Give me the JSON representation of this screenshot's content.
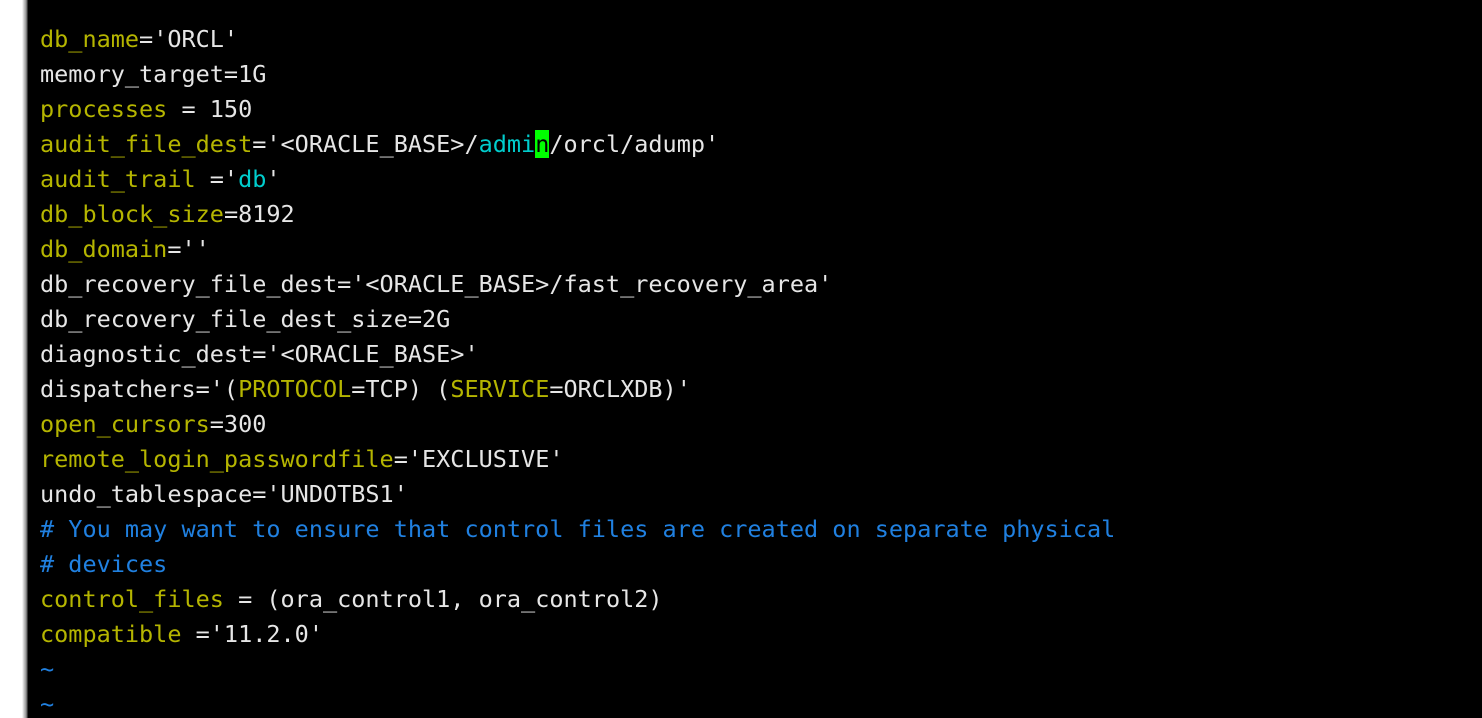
{
  "window": {
    "type": "terminal-text-editor",
    "editor": "vim",
    "background_color": "#000000",
    "gutter_color": "#ffffff"
  },
  "colors": {
    "keyword": "#b5b500",
    "value": "#e6e6e6",
    "string": "#00cdcd",
    "comment": "#2080e0",
    "cursor_bg": "#00ff00",
    "cursor_fg": "#000000",
    "background": "#000000"
  },
  "cursor": {
    "glyph": "n",
    "line_index": 3,
    "column_text": "admin"
  },
  "buffer": {
    "lines": [
      {
        "id": "line-db-name",
        "tokens": [
          {
            "t": "db_name",
            "c": "kw"
          },
          {
            "t": "='ORCL'",
            "c": "val"
          }
        ]
      },
      {
        "id": "line-memory-target",
        "tokens": [
          {
            "t": "memory_target=1G",
            "c": "val"
          }
        ]
      },
      {
        "id": "line-processes",
        "tokens": [
          {
            "t": "processes",
            "c": "kw"
          },
          {
            "t": " = 150",
            "c": "val"
          }
        ]
      },
      {
        "id": "line-audit-file-dest",
        "tokens": [
          {
            "t": "audit_file_dest",
            "c": "kw"
          },
          {
            "t": "='<ORACLE_BASE>/",
            "c": "val"
          },
          {
            "t": "admi",
            "c": "str"
          },
          {
            "t": "n",
            "c": "cursor"
          },
          {
            "t": "/orcl/adump'",
            "c": "val"
          }
        ]
      },
      {
        "id": "line-audit-trail",
        "tokens": [
          {
            "t": "audit_trail",
            "c": "kw"
          },
          {
            "t": " ='",
            "c": "val"
          },
          {
            "t": "db",
            "c": "str"
          },
          {
            "t": "'",
            "c": "val"
          }
        ]
      },
      {
        "id": "line-db-block-size",
        "tokens": [
          {
            "t": "db_block_size",
            "c": "kw"
          },
          {
            "t": "=8192",
            "c": "val"
          }
        ]
      },
      {
        "id": "line-db-domain",
        "tokens": [
          {
            "t": "db_domain",
            "c": "kw"
          },
          {
            "t": "=''",
            "c": "val"
          }
        ]
      },
      {
        "id": "line-db-recovery-file-dest",
        "tokens": [
          {
            "t": "db_recovery_file_dest='<ORACLE_BASE>/fast_recovery_area'",
            "c": "val"
          }
        ]
      },
      {
        "id": "line-db-recovery-file-dest-size",
        "tokens": [
          {
            "t": "db_recovery_file_dest_size=2G",
            "c": "val"
          }
        ]
      },
      {
        "id": "line-diagnostic-dest",
        "tokens": [
          {
            "t": "diagnostic_dest='<ORACLE_BASE>'",
            "c": "val"
          }
        ]
      },
      {
        "id": "line-dispatchers",
        "tokens": [
          {
            "t": "dispatchers='(",
            "c": "val"
          },
          {
            "t": "PROTOCOL",
            "c": "kw"
          },
          {
            "t": "=TCP) (",
            "c": "val"
          },
          {
            "t": "SERVICE",
            "c": "kw"
          },
          {
            "t": "=ORCLXDB)'",
            "c": "val"
          }
        ]
      },
      {
        "id": "line-open-cursors",
        "tokens": [
          {
            "t": "open_cursors",
            "c": "kw"
          },
          {
            "t": "=300",
            "c": "val"
          }
        ]
      },
      {
        "id": "line-remote-login-passwordfile",
        "tokens": [
          {
            "t": "remote_login_passwordfile",
            "c": "kw"
          },
          {
            "t": "='EXCLUSIVE'",
            "c": "val"
          }
        ]
      },
      {
        "id": "line-undo-tablespace",
        "tokens": [
          {
            "t": "undo_tablespace='UNDOTBS1'",
            "c": "val"
          }
        ]
      },
      {
        "id": "line-comment-1",
        "tokens": [
          {
            "t": "# You may want to ensure that control files are created on separate physical",
            "c": "cmt"
          }
        ]
      },
      {
        "id": "line-comment-2",
        "tokens": [
          {
            "t": "# devices",
            "c": "cmt"
          }
        ]
      },
      {
        "id": "line-control-files",
        "tokens": [
          {
            "t": "control_files",
            "c": "kw"
          },
          {
            "t": " = (ora_control1, ora_control2)",
            "c": "val"
          }
        ]
      },
      {
        "id": "line-compatible",
        "tokens": [
          {
            "t": "compatible",
            "c": "kw"
          },
          {
            "t": " ='11.2.0'",
            "c": "val"
          }
        ]
      },
      {
        "id": "line-tilde-1",
        "tokens": [
          {
            "t": "~",
            "c": "tilde"
          }
        ]
      },
      {
        "id": "line-tilde-2",
        "tokens": [
          {
            "t": "~",
            "c": "tilde"
          }
        ]
      }
    ]
  }
}
